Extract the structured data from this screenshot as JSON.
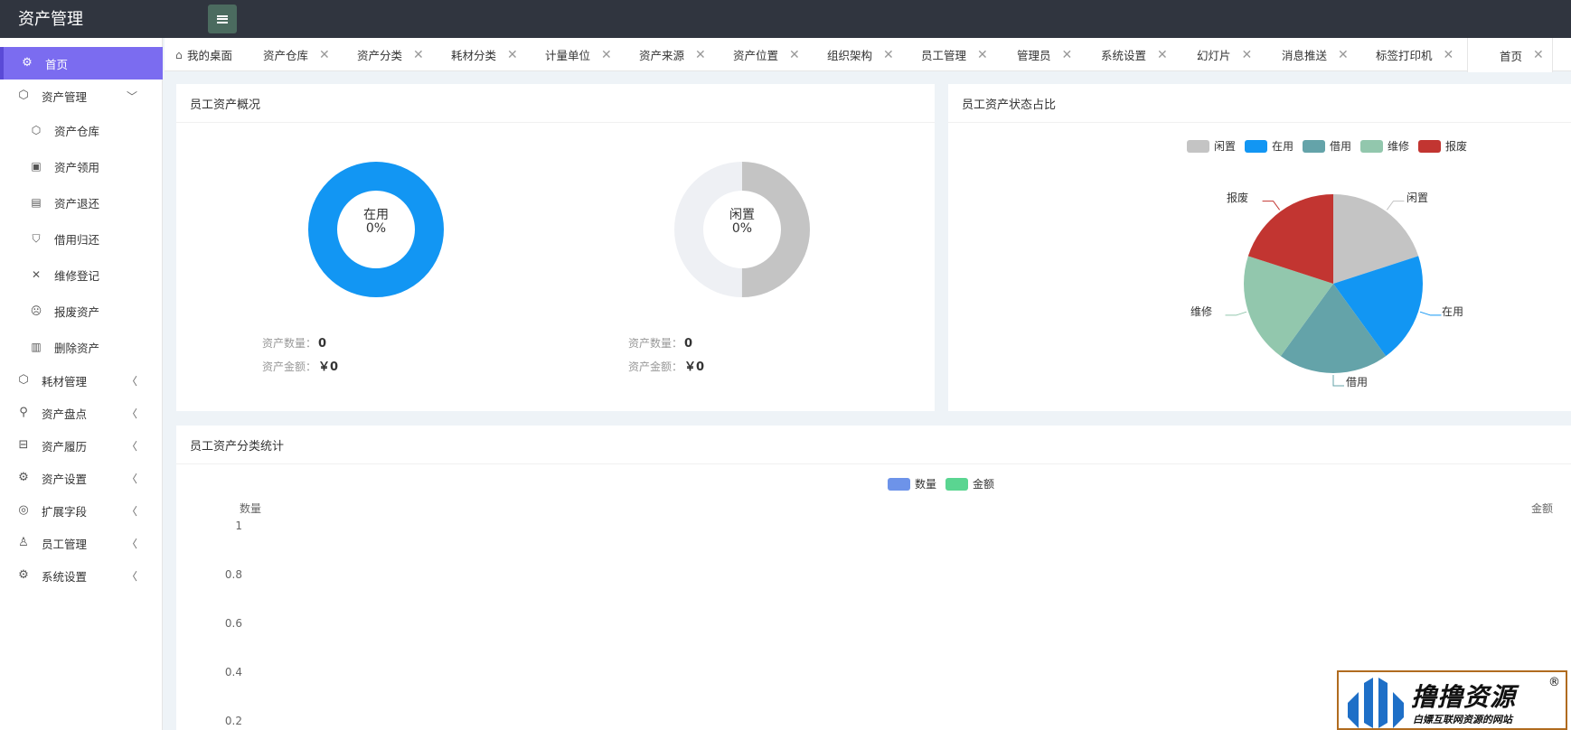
{
  "app": {
    "title": "资产管理"
  },
  "sidebar": {
    "items": [
      {
        "label": "首页",
        "icon": "home-icon",
        "active": true
      },
      {
        "label": "资产管理",
        "icon": "cube-icon",
        "expanded": true
      },
      {
        "label": "资产仓库",
        "icon": "box-icon",
        "sub": true
      },
      {
        "label": "资产领用",
        "icon": "receive-icon",
        "sub": true
      },
      {
        "label": "资产退还",
        "icon": "return-icon",
        "sub": true
      },
      {
        "label": "借用归还",
        "icon": "borrow-icon",
        "sub": true
      },
      {
        "label": "维修登记",
        "icon": "wrench-icon",
        "sub": true
      },
      {
        "label": "报废资产",
        "icon": "scrap-icon",
        "sub": true
      },
      {
        "label": "删除资产",
        "icon": "trash-icon",
        "sub": true
      },
      {
        "label": "耗材管理",
        "icon": "cube-icon"
      },
      {
        "label": "资产盘点",
        "icon": "search-icon"
      },
      {
        "label": "资产履历",
        "icon": "book-icon"
      },
      {
        "label": "资产设置",
        "icon": "gear-icon"
      },
      {
        "label": "扩展字段",
        "icon": "extend-icon"
      },
      {
        "label": "员工管理",
        "icon": "user-icon"
      },
      {
        "label": "系统设置",
        "icon": "gear-icon"
      }
    ]
  },
  "tabs": [
    {
      "label": "我的桌面",
      "closable": false
    },
    {
      "label": "资产仓库",
      "closable": true
    },
    {
      "label": "资产分类",
      "closable": true
    },
    {
      "label": "耗材分类",
      "closable": true
    },
    {
      "label": "计量单位",
      "closable": true
    },
    {
      "label": "资产来源",
      "closable": true
    },
    {
      "label": "资产位置",
      "closable": true
    },
    {
      "label": "组织架构",
      "closable": true
    },
    {
      "label": "员工管理",
      "closable": true
    },
    {
      "label": "管理员",
      "closable": true
    },
    {
      "label": "系统设置",
      "closable": true
    },
    {
      "label": "幻灯片",
      "closable": true
    },
    {
      "label": "消息推送",
      "closable": true
    },
    {
      "label": "标签打印机",
      "closable": true
    },
    {
      "label": "首页",
      "closable": true,
      "current": true
    }
  ],
  "overview": {
    "title": "员工资产概况",
    "donuts": [
      {
        "label": "在用",
        "percent": "0%",
        "fraction": 1,
        "color": "#1296f3",
        "count_label": "资产数量：",
        "count": "0",
        "amount_label": "资产金额：",
        "amount": "￥0"
      },
      {
        "label": "闲置",
        "percent": "0%",
        "fraction": 0.5,
        "color": "#c4c4c4",
        "count_label": "资产数量：",
        "count": "0",
        "amount_label": "资产金额：",
        "amount": "￥0"
      }
    ]
  },
  "status": {
    "title": "员工资产状态占比",
    "chart_data": {
      "type": "pie",
      "legend_position": "top",
      "slices": [
        {
          "name": "闲置",
          "value": 1,
          "color": "#c4c4c4"
        },
        {
          "name": "在用",
          "value": 1,
          "color": "#1296f3"
        },
        {
          "name": "借用",
          "value": 1,
          "color": "#64a3a9"
        },
        {
          "name": "维修",
          "value": 1,
          "color": "#92c7ad"
        },
        {
          "name": "报废",
          "value": 1,
          "color": "#c23531"
        }
      ]
    }
  },
  "category": {
    "title": "员工资产分类统计",
    "chart_data": {
      "type": "bar",
      "legend_position": "top",
      "series": [
        {
          "name": "数量",
          "color": "#6d93e9",
          "values": []
        },
        {
          "name": "金额",
          "color": "#5ad591",
          "values": []
        }
      ],
      "categories": [],
      "ylabel": "数量",
      "y2label": "金额",
      "yticks": [
        "1",
        "0.8",
        "0.6",
        "0.4",
        "0.2"
      ],
      "ylim": [
        0,
        1
      ]
    }
  },
  "watermark": {
    "text": "撸撸资源",
    "sub": "白嫖互联网资源的网站",
    "reg": "®"
  }
}
